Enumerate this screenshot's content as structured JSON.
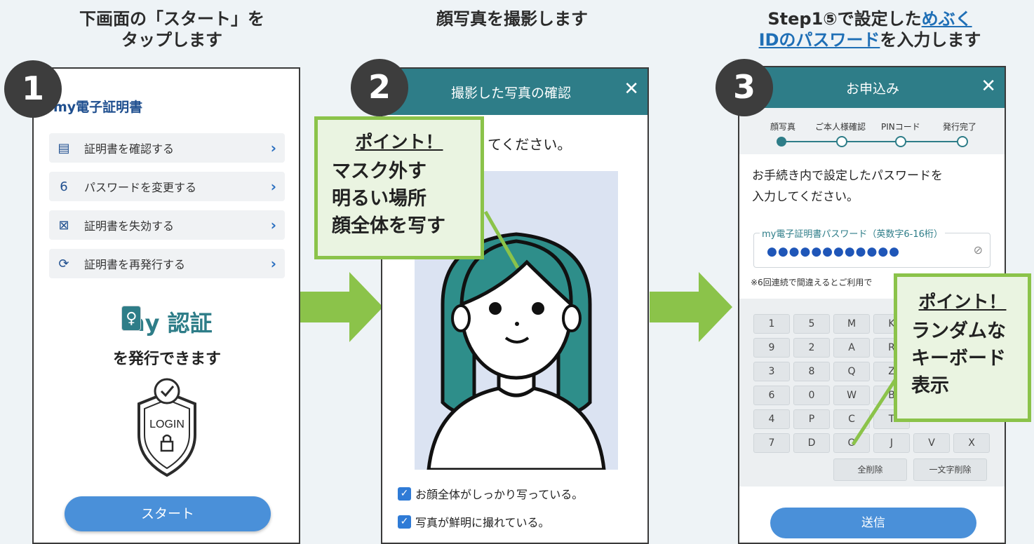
{
  "captions": {
    "step1_line1": "下画面の「スタート」を",
    "step1_line2": "タップします",
    "step2": "顔写真を撮影します",
    "step3_line1_a": "Step1⑤で設定した",
    "step3_line1_link": "めぶく",
    "step3_line2_link": "IDのパスワード",
    "step3_line2_b": "を入力します"
  },
  "badges": {
    "one": "1",
    "two": "2",
    "three": "3"
  },
  "colors": {
    "teal": "#2e7d88",
    "green": "#8bc34a",
    "blue": "#4a90d9",
    "dark": "#3d3d3d"
  },
  "screen1": {
    "brand": "my電子証明書",
    "menu": [
      {
        "label": "証明書を確認する",
        "icon": "document-icon"
      },
      {
        "label": "パスワードを変更する",
        "icon": "lock-open-icon"
      },
      {
        "label": "証明書を失効する",
        "icon": "document-x-icon"
      },
      {
        "label": "証明書を再発行する",
        "icon": "refresh-icon"
      }
    ],
    "logo_text": "my 認証",
    "issue_text": "を発行できます",
    "shield_text": "LOGIN",
    "start_button": "スタート"
  },
  "screen2": {
    "header_title": "撮影した写真の確認",
    "close": "✕",
    "instruction": "てください。",
    "checks": [
      "お顔全体がしっかり写っている。",
      "写真が鮮明に撮れている。"
    ],
    "callout": {
      "title": "ポイント！",
      "lines": [
        "マスク外す",
        "明るい場所",
        "顔全体を写す"
      ]
    }
  },
  "screen3": {
    "header_title": "お申込み",
    "close": "✕",
    "steps": [
      "顔写真",
      "ご本人様確認",
      "PINコード",
      "発行完了"
    ],
    "instruction_line1": "お手続き内で設定したパスワードを",
    "instruction_line2": "入力してください。",
    "password_label": "my電子証明書パスワード（英数字6-16桁）",
    "password_dots": "●●●●●●●●●●●●",
    "note": "※6回連続で間違えるとご利用で",
    "keyboard_rows": [
      [
        "1",
        "5",
        "M",
        "K"
      ],
      [
        "9",
        "2",
        "A",
        "R"
      ],
      [
        "3",
        "8",
        "Q",
        "Z"
      ],
      [
        "6",
        "0",
        "W",
        "B"
      ],
      [
        "4",
        "P",
        "C",
        "T"
      ],
      [
        "7",
        "D",
        "O",
        "J",
        "V",
        "X"
      ]
    ],
    "delete_all": "全削除",
    "delete_one": "一文字削除",
    "send_button": "送信",
    "callout": {
      "title": "ポイント！",
      "lines": [
        "ランダムな",
        "キーボード",
        "表示"
      ]
    }
  }
}
